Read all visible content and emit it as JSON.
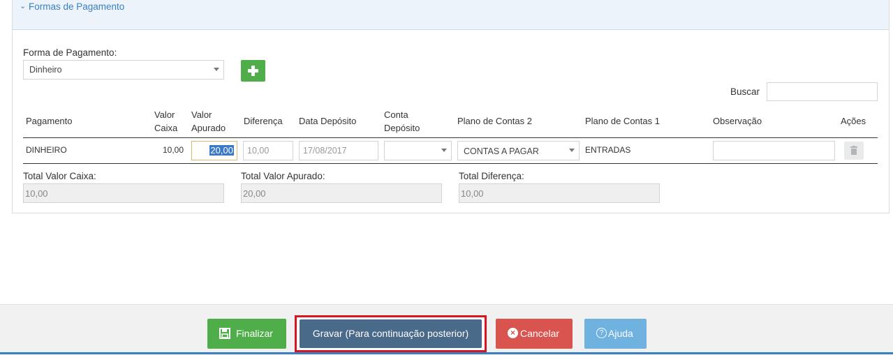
{
  "section": {
    "title": "Formas de Pagamento"
  },
  "form": {
    "forma_label": "Forma de Pagamento:",
    "forma_value": "Dinheiro",
    "search_label": "Buscar",
    "search_value": ""
  },
  "table": {
    "headers": {
      "pagamento": "Pagamento",
      "valor_caixa_1": "Valor",
      "valor_caixa_2": "Caixa",
      "valor_apurado_1": "Valor",
      "valor_apurado_2": "Apurado",
      "diferenca": "Diferença",
      "data_deposito": "Data Depósito",
      "conta_deposito_1": "Conta",
      "conta_deposito_2": "Depósito",
      "plano2": "Plano de Contas 2",
      "plano1": "Plano de Contas 1",
      "observacao": "Observação",
      "acoes": "Ações"
    },
    "row": {
      "pagamento": "DINHEIRO",
      "valor_caixa": "10,00",
      "valor_apurado": "20,00",
      "diferenca": "10,00",
      "data_deposito": "17/08/2017",
      "conta_deposito": "",
      "plano2": "CONTAS A PAGAR",
      "plano1": "ENTRADAS",
      "observacao": ""
    }
  },
  "totals": {
    "caixa_label": "Total Valor Caixa:",
    "caixa_value": "10,00",
    "apurado_label": "Total Valor Apurado:",
    "apurado_value": "20,00",
    "diferenca_label": "Total Diferença:",
    "diferenca_value": "10,00"
  },
  "buttons": {
    "finalizar": "Finalizar",
    "gravar": "Gravar (Para continuação posterior)",
    "cancelar": "Cancelar",
    "ajuda": "Ajuda"
  },
  "colors": {
    "finalizar": "#4fad4a",
    "gravar": "#4a6a8a",
    "cancelar": "#d9534f",
    "ajuda": "#6fb2e0",
    "highlight": "#d9151f"
  }
}
